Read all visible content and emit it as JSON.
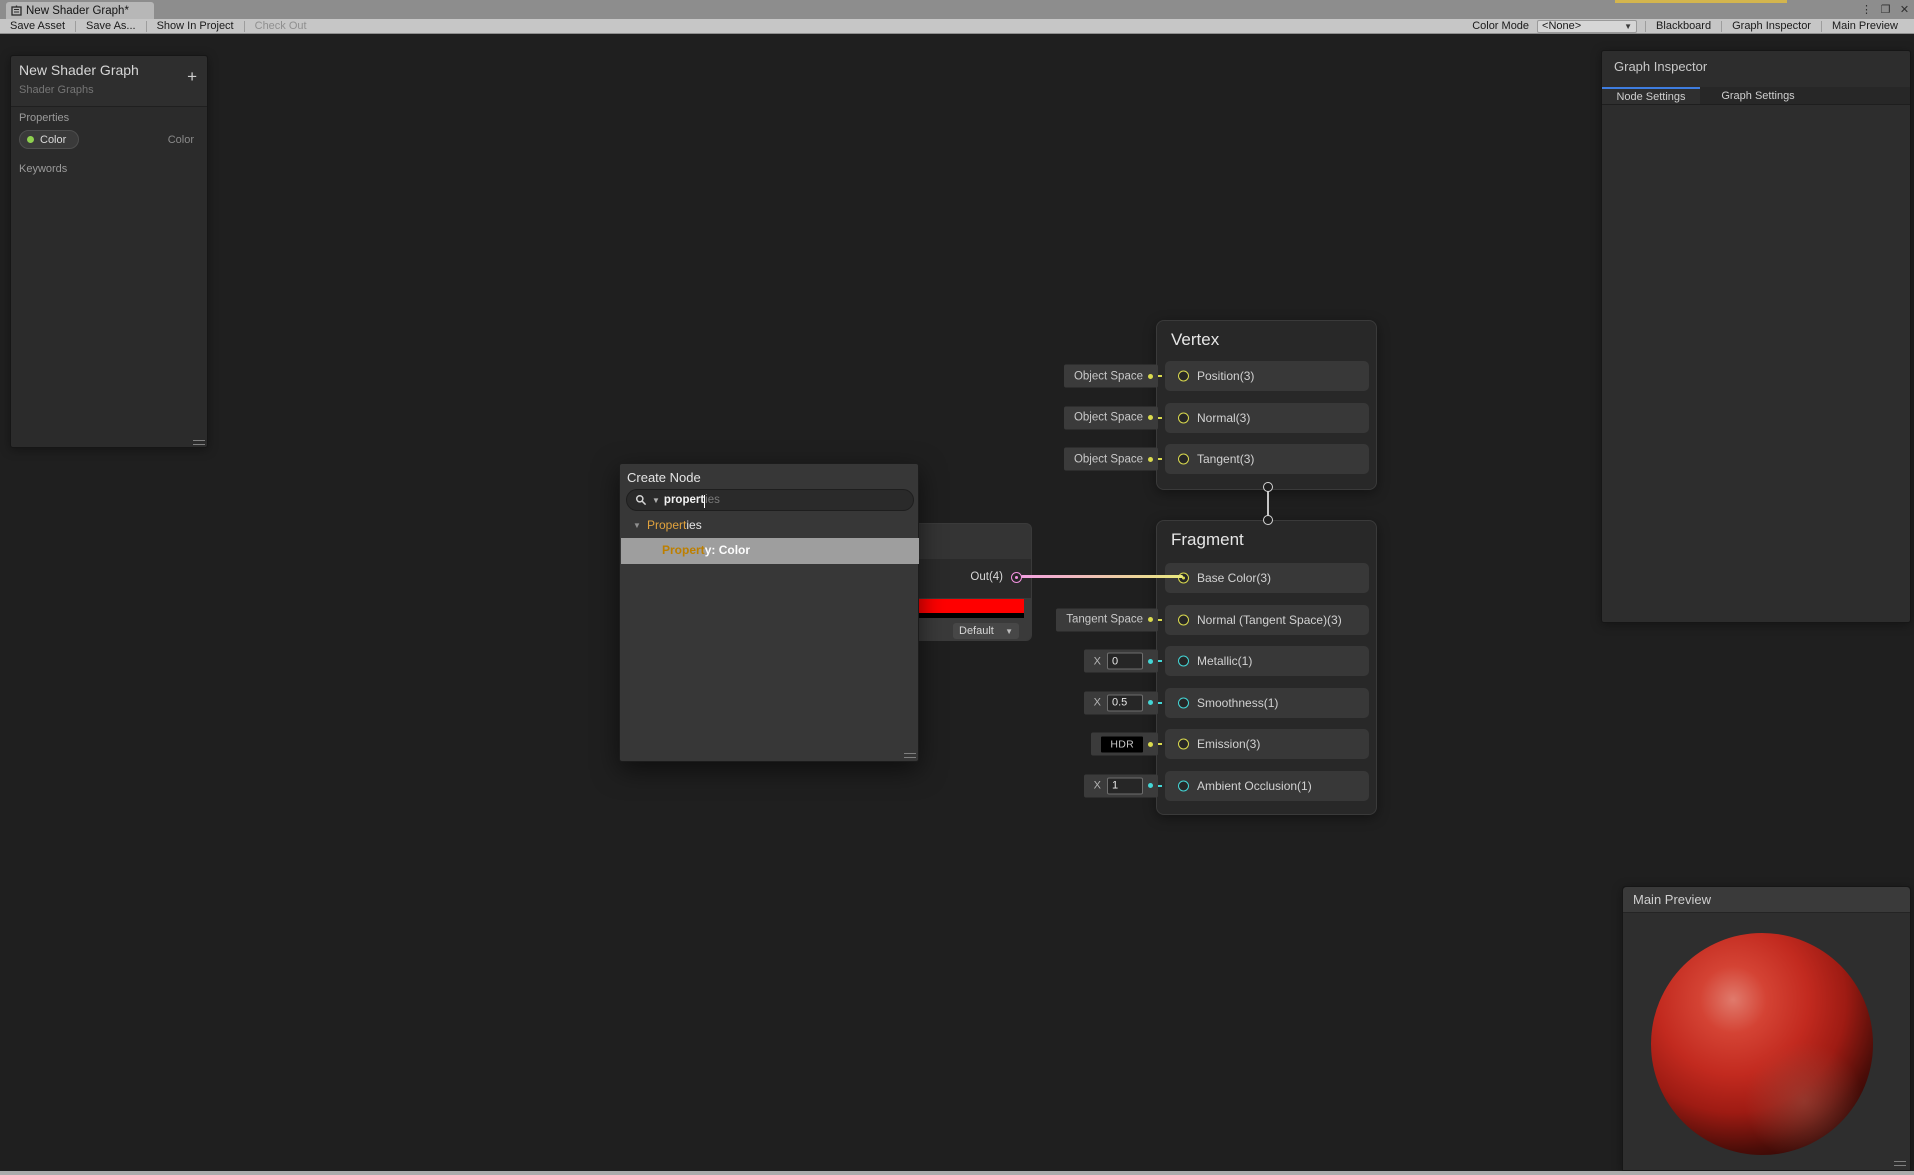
{
  "window": {
    "tab_title": "New Shader Graph*",
    "controls": {
      "menu": "⋮",
      "restore": "❐",
      "close": "✕"
    }
  },
  "toolbar": {
    "left": [
      {
        "label": "Save Asset",
        "disabled": false
      },
      {
        "label": "Save As...",
        "disabled": false
      },
      {
        "label": "Show In Project",
        "disabled": false
      },
      {
        "label": "Check Out",
        "disabled": true
      }
    ],
    "color_mode": {
      "label": "Color Mode",
      "value": "<None>"
    },
    "right": [
      {
        "label": "Blackboard"
      },
      {
        "label": "Graph Inspector"
      },
      {
        "label": "Main Preview"
      }
    ]
  },
  "blackboard": {
    "title": "New Shader Graph",
    "subtitle": "Shader Graphs",
    "add_button": "+",
    "properties_label": "Properties",
    "keywords_label": "Keywords",
    "property": {
      "name": "Color",
      "type": "Color"
    }
  },
  "inspector": {
    "title": "Graph Inspector",
    "tabs": [
      {
        "label": "Node Settings",
        "active": true
      },
      {
        "label": "Graph Settings",
        "active": false
      }
    ]
  },
  "preview": {
    "title": "Main Preview"
  },
  "create_node": {
    "title": "Create Node",
    "search": {
      "typed": "propert",
      "suggestion": "ies"
    },
    "category": {
      "match": "Propert",
      "rest": "ies"
    },
    "result": {
      "match": "Propert",
      "rest": "y: Color"
    }
  },
  "color_node": {
    "out_label": "Out(4)",
    "mode_dropdown": "Default"
  },
  "vertex_node": {
    "title": "Vertex",
    "rows": [
      {
        "label": "Position(3)",
        "port_color": "yellow",
        "connected": false,
        "chip": {
          "type": "label",
          "text": "Object Space",
          "dot": "yellow"
        }
      },
      {
        "label": "Normal(3)",
        "port_color": "yellow",
        "connected": false,
        "chip": {
          "type": "label",
          "text": "Object Space",
          "dot": "yellow"
        }
      },
      {
        "label": "Tangent(3)",
        "port_color": "yellow",
        "connected": false,
        "chip": {
          "type": "label",
          "text": "Object Space",
          "dot": "yellow"
        }
      }
    ]
  },
  "fragment_node": {
    "title": "Fragment",
    "rows": [
      {
        "label": "Base Color(3)",
        "port_color": "yellow",
        "connected": true,
        "chip": null
      },
      {
        "label": "Normal (Tangent Space)(3)",
        "port_color": "yellow",
        "connected": false,
        "chip": {
          "type": "label",
          "text": "Tangent Space",
          "dot": "yellow"
        }
      },
      {
        "label": "Metallic(1)",
        "port_color": "cyan",
        "connected": false,
        "chip": {
          "type": "value",
          "x_label": "X",
          "value": "0",
          "dot": "cyan"
        }
      },
      {
        "label": "Smoothness(1)",
        "port_color": "cyan",
        "connected": false,
        "chip": {
          "type": "value",
          "x_label": "X",
          "value": "0.5",
          "dot": "cyan"
        }
      },
      {
        "label": "Emission(3)",
        "port_color": "yellow",
        "connected": false,
        "chip": {
          "type": "hdr",
          "text": "HDR",
          "dot": "yellow"
        }
      },
      {
        "label": "Ambient Occlusion(1)",
        "port_color": "cyan",
        "connected": false,
        "chip": {
          "type": "value",
          "x_label": "X",
          "value": "1",
          "dot": "cyan"
        }
      }
    ]
  },
  "colors": {
    "port_yellow": "#d9d94e",
    "port_cyan": "#44d6d6",
    "port_pink": "#f090dd",
    "wire_from": "#f2a0e0",
    "wire_to": "#e9e97d",
    "swatch_red": "#ff0000",
    "property_dot_green": "#8fd14f",
    "tab_accent_blue": "#3e7de0",
    "selection_gray": "#9e9e9e",
    "search_match_orange": "#e2a33d"
  }
}
